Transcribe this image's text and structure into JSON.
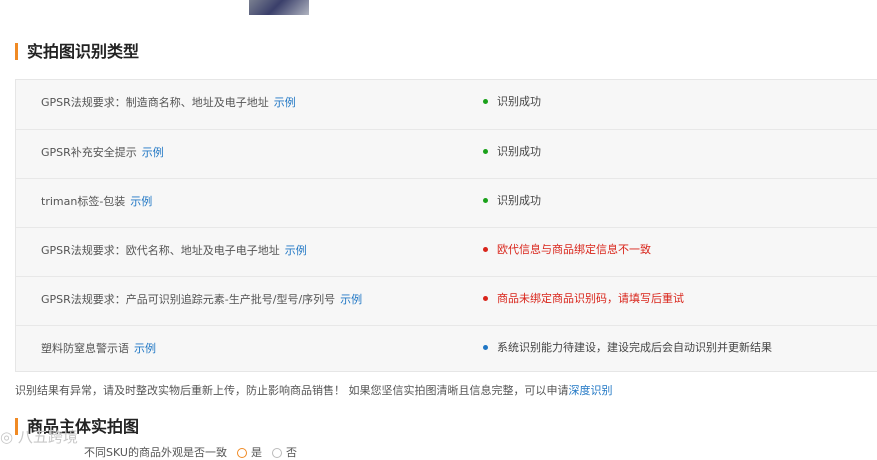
{
  "section1": {
    "title": "实拍图识别类型"
  },
  "rows": [
    {
      "requirement": "GPSR法规要求：制造商名称、地址及电子地址",
      "example": "示例",
      "status": "识别成功",
      "status_color": "#1aa11a"
    },
    {
      "requirement": "GPSR补充安全提示",
      "example": "示例",
      "status": "识别成功",
      "status_color": "#1aa11a"
    },
    {
      "requirement": "triman标签-包装",
      "example": "示例",
      "status": "识别成功",
      "status_color": "#1aa11a"
    },
    {
      "requirement": "GPSR法规要求：欧代名称、地址及电子电子地址",
      "example": "示例",
      "status": "欧代信息与商品绑定信息不一致",
      "status_color": "#d9251b"
    },
    {
      "requirement": "GPSR法规要求：产品可识别追踪元素-生产批号/型号/序列号",
      "example": "示例",
      "status": "商品未绑定商品识别码，请填写后重试",
      "status_color": "#d9251b"
    },
    {
      "requirement": "塑料防窒息警示语",
      "example": "示例",
      "status": "系统识别能力待建设，建设完成后会自动识别并更新结果",
      "status_color": "#1f76c4"
    }
  ],
  "note": {
    "text": "识别结果有异常，请及时整改实物后重新上传，防止影响商品销售！ 如果您坚信实拍图清晰且信息完整，可以申请",
    "link": "深度识别"
  },
  "section2": {
    "title": "商品主体实拍图"
  },
  "question": {
    "text": "不同SKU的商品外观是否一致",
    "option_yes": "是",
    "option_no": "否"
  },
  "watermark": {
    "text": "◎ 八五跨境"
  }
}
